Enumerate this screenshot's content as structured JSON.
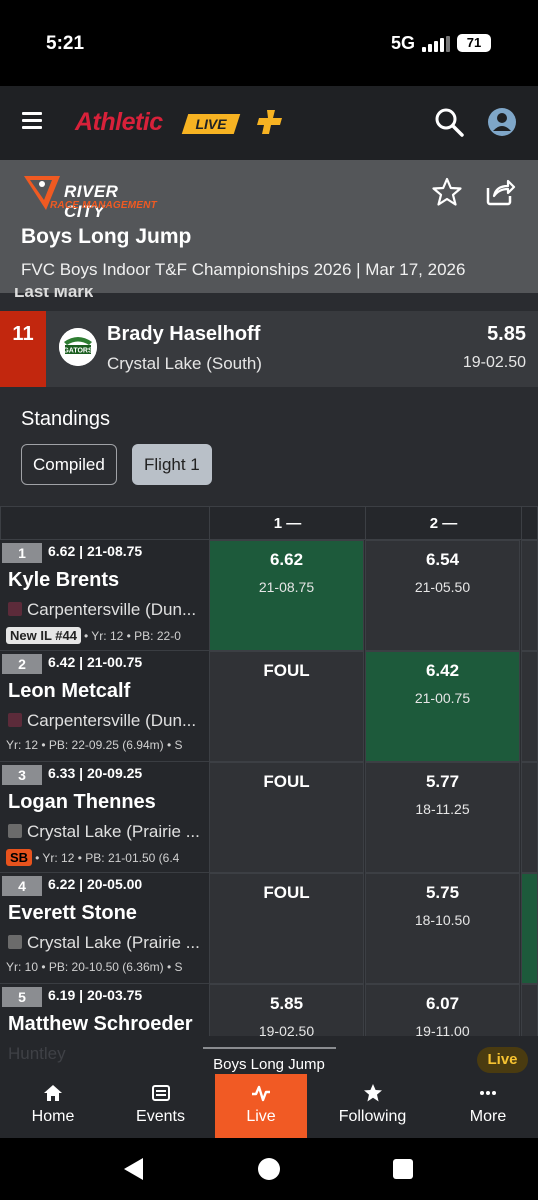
{
  "status": {
    "time": "5:21",
    "network": "5G",
    "battery": "71"
  },
  "app": {
    "brand_athletic": "Athletic",
    "brand_live": "LIVE"
  },
  "event": {
    "org_line1": "RIVER CITY",
    "org_line2": "RACE MANAGEMENT",
    "title": "Boys Long Jump",
    "subtitle": "FVC Boys Indoor T&F Championships 2026 | Mar 17, 2026",
    "clipped_label": "Last Mark"
  },
  "last_mark": {
    "place": "11",
    "athlete": "Brady Haselhoff",
    "team": "Crystal Lake (South)",
    "mark": "5.85",
    "imperial": "19-02.50",
    "logo_text": "GATORS"
  },
  "standings": {
    "label": "Standings",
    "chips": [
      "Compiled",
      "Flight 1"
    ]
  },
  "table": {
    "headers": [
      "1 —",
      "2 —"
    ],
    "rows": [
      {
        "place": "1",
        "best": "6.62 | 21-08.75",
        "name": "Kyle Brents",
        "team": "Carpentersville (Dun...",
        "badge": "New IL #44",
        "meta": "• Yr: 12 • PB: 22-0",
        "a1": {
          "mark": "6.62",
          "imp": "21-08.75"
        },
        "a2": {
          "mark": "6.54",
          "imp": "21-05.50"
        }
      },
      {
        "place": "2",
        "best": "6.42 | 21-00.75",
        "name": "Leon Metcalf",
        "team": "Carpentersville (Dun...",
        "badge": "",
        "meta": "Yr: 12 • PB: 22-09.25 (6.94m) • S",
        "a1": {
          "mark": "FOUL",
          "imp": ""
        },
        "a2": {
          "mark": "6.42",
          "imp": "21-00.75"
        }
      },
      {
        "place": "3",
        "best": "6.33 | 20-09.25",
        "name": "Logan Thennes",
        "team": "Crystal Lake (Prairie ...",
        "badge": "SB",
        "meta": "• Yr: 12 • PB: 21-01.50 (6.4",
        "a1": {
          "mark": "FOUL",
          "imp": ""
        },
        "a2": {
          "mark": "5.77",
          "imp": "18-11.25"
        }
      },
      {
        "place": "4",
        "best": "6.22 | 20-05.00",
        "name": "Everett Stone",
        "team": "Crystal Lake (Prairie ...",
        "badge": "",
        "meta": "Yr: 10 • PB: 20-10.50 (6.36m) • S",
        "a1": {
          "mark": "FOUL",
          "imp": ""
        },
        "a2": {
          "mark": "5.75",
          "imp": "18-10.50"
        }
      },
      {
        "place": "5",
        "best": "6.19 | 20-03.75",
        "name": "Matthew Schroeder",
        "team": "",
        "badge": "",
        "meta": "",
        "a1": {
          "mark": "5.85",
          "imp": "19-02.50"
        },
        "a2": {
          "mark": "6.07",
          "imp": "19-11.00"
        }
      }
    ]
  },
  "now_playing": {
    "title": "Boys Long Jump",
    "live": "Live",
    "ghost_team": "Huntley"
  },
  "nav": {
    "items": [
      "Home",
      "Events",
      "Live",
      "Following",
      "More"
    ]
  },
  "colors": {
    "accent": "#f15a24",
    "best_mark": "#1d5a3b",
    "place_highlight": "#c2270e",
    "brand_red": "#d8213a",
    "brand_yellow": "#f7b322"
  }
}
